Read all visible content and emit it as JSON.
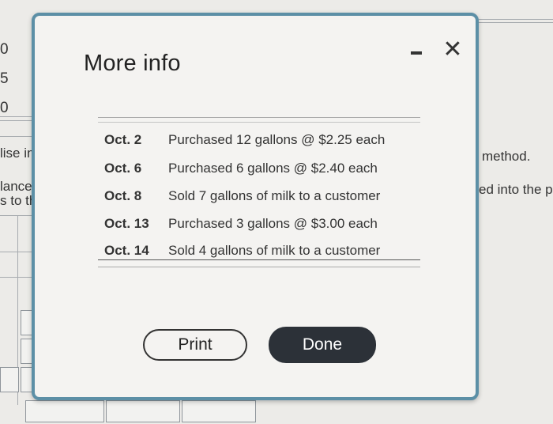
{
  "background": {
    "left_values": [
      "0",
      "5",
      "0"
    ],
    "left_texts": [
      "lise in",
      "lance",
      "s to th"
    ],
    "right_texts": [
      "method.",
      "ed into the p"
    ]
  },
  "modal": {
    "title": "More info",
    "minimize_icon": "minimize-icon",
    "close_icon": "close-icon",
    "close_glyph": "✕",
    "rows": [
      {
        "date": "Oct. 2",
        "desc": "Purchased 12 gallons @ $2.25 each"
      },
      {
        "date": "Oct. 6",
        "desc": "Purchased 6 gallons @ $2.40 each"
      },
      {
        "date": "Oct. 8",
        "desc": "Sold 7 gallons of milk to a customer"
      },
      {
        "date": "Oct. 13",
        "desc": "Purchased 3 gallons @ $3.00 each"
      },
      {
        "date": "Oct. 14",
        "desc": "Sold 4 gallons of milk to a customer"
      }
    ],
    "print_label": "Print",
    "done_label": "Done",
    "accent_color": "#5c8fa6",
    "done_color": "#2c3138"
  }
}
